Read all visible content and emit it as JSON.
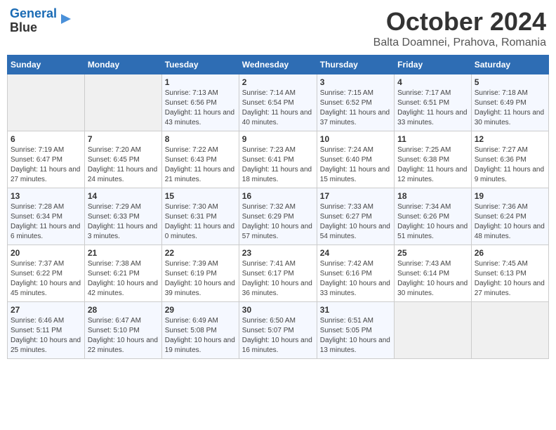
{
  "header": {
    "logo_line1": "General",
    "logo_line2": "Blue",
    "month_title": "October 2024",
    "location": "Balta Doamnei, Prahova, Romania"
  },
  "weekdays": [
    "Sunday",
    "Monday",
    "Tuesday",
    "Wednesday",
    "Thursday",
    "Friday",
    "Saturday"
  ],
  "weeks": [
    [
      {
        "day": "",
        "info": ""
      },
      {
        "day": "",
        "info": ""
      },
      {
        "day": "1",
        "info": "Sunrise: 7:13 AM\nSunset: 6:56 PM\nDaylight: 11 hours and 43 minutes."
      },
      {
        "day": "2",
        "info": "Sunrise: 7:14 AM\nSunset: 6:54 PM\nDaylight: 11 hours and 40 minutes."
      },
      {
        "day": "3",
        "info": "Sunrise: 7:15 AM\nSunset: 6:52 PM\nDaylight: 11 hours and 37 minutes."
      },
      {
        "day": "4",
        "info": "Sunrise: 7:17 AM\nSunset: 6:51 PM\nDaylight: 11 hours and 33 minutes."
      },
      {
        "day": "5",
        "info": "Sunrise: 7:18 AM\nSunset: 6:49 PM\nDaylight: 11 hours and 30 minutes."
      }
    ],
    [
      {
        "day": "6",
        "info": "Sunrise: 7:19 AM\nSunset: 6:47 PM\nDaylight: 11 hours and 27 minutes."
      },
      {
        "day": "7",
        "info": "Sunrise: 7:20 AM\nSunset: 6:45 PM\nDaylight: 11 hours and 24 minutes."
      },
      {
        "day": "8",
        "info": "Sunrise: 7:22 AM\nSunset: 6:43 PM\nDaylight: 11 hours and 21 minutes."
      },
      {
        "day": "9",
        "info": "Sunrise: 7:23 AM\nSunset: 6:41 PM\nDaylight: 11 hours and 18 minutes."
      },
      {
        "day": "10",
        "info": "Sunrise: 7:24 AM\nSunset: 6:40 PM\nDaylight: 11 hours and 15 minutes."
      },
      {
        "day": "11",
        "info": "Sunrise: 7:25 AM\nSunset: 6:38 PM\nDaylight: 11 hours and 12 minutes."
      },
      {
        "day": "12",
        "info": "Sunrise: 7:27 AM\nSunset: 6:36 PM\nDaylight: 11 hours and 9 minutes."
      }
    ],
    [
      {
        "day": "13",
        "info": "Sunrise: 7:28 AM\nSunset: 6:34 PM\nDaylight: 11 hours and 6 minutes."
      },
      {
        "day": "14",
        "info": "Sunrise: 7:29 AM\nSunset: 6:33 PM\nDaylight: 11 hours and 3 minutes."
      },
      {
        "day": "15",
        "info": "Sunrise: 7:30 AM\nSunset: 6:31 PM\nDaylight: 11 hours and 0 minutes."
      },
      {
        "day": "16",
        "info": "Sunrise: 7:32 AM\nSunset: 6:29 PM\nDaylight: 10 hours and 57 minutes."
      },
      {
        "day": "17",
        "info": "Sunrise: 7:33 AM\nSunset: 6:27 PM\nDaylight: 10 hours and 54 minutes."
      },
      {
        "day": "18",
        "info": "Sunrise: 7:34 AM\nSunset: 6:26 PM\nDaylight: 10 hours and 51 minutes."
      },
      {
        "day": "19",
        "info": "Sunrise: 7:36 AM\nSunset: 6:24 PM\nDaylight: 10 hours and 48 minutes."
      }
    ],
    [
      {
        "day": "20",
        "info": "Sunrise: 7:37 AM\nSunset: 6:22 PM\nDaylight: 10 hours and 45 minutes."
      },
      {
        "day": "21",
        "info": "Sunrise: 7:38 AM\nSunset: 6:21 PM\nDaylight: 10 hours and 42 minutes."
      },
      {
        "day": "22",
        "info": "Sunrise: 7:39 AM\nSunset: 6:19 PM\nDaylight: 10 hours and 39 minutes."
      },
      {
        "day": "23",
        "info": "Sunrise: 7:41 AM\nSunset: 6:17 PM\nDaylight: 10 hours and 36 minutes."
      },
      {
        "day": "24",
        "info": "Sunrise: 7:42 AM\nSunset: 6:16 PM\nDaylight: 10 hours and 33 minutes."
      },
      {
        "day": "25",
        "info": "Sunrise: 7:43 AM\nSunset: 6:14 PM\nDaylight: 10 hours and 30 minutes."
      },
      {
        "day": "26",
        "info": "Sunrise: 7:45 AM\nSunset: 6:13 PM\nDaylight: 10 hours and 27 minutes."
      }
    ],
    [
      {
        "day": "27",
        "info": "Sunrise: 6:46 AM\nSunset: 5:11 PM\nDaylight: 10 hours and 25 minutes."
      },
      {
        "day": "28",
        "info": "Sunrise: 6:47 AM\nSunset: 5:10 PM\nDaylight: 10 hours and 22 minutes."
      },
      {
        "day": "29",
        "info": "Sunrise: 6:49 AM\nSunset: 5:08 PM\nDaylight: 10 hours and 19 minutes."
      },
      {
        "day": "30",
        "info": "Sunrise: 6:50 AM\nSunset: 5:07 PM\nDaylight: 10 hours and 16 minutes."
      },
      {
        "day": "31",
        "info": "Sunrise: 6:51 AM\nSunset: 5:05 PM\nDaylight: 10 hours and 13 minutes."
      },
      {
        "day": "",
        "info": ""
      },
      {
        "day": "",
        "info": ""
      }
    ]
  ]
}
